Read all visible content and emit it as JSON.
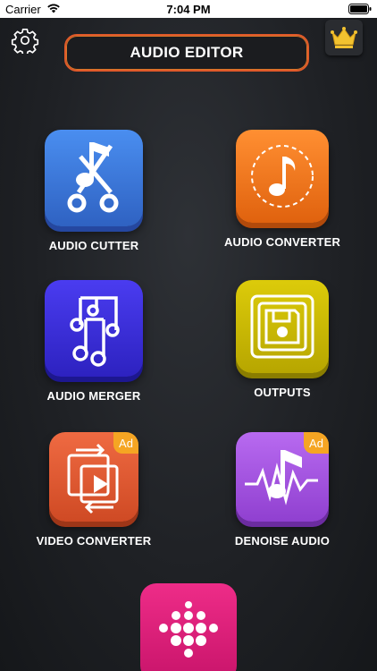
{
  "status_bar": {
    "carrier": "Carrier",
    "time": "7:04 PM"
  },
  "header": {
    "title": "AUDIO EDITOR"
  },
  "tiles": [
    {
      "label": "AUDIO CUTTER",
      "color": "#3f7fd9"
    },
    {
      "label": "AUDIO CONVERTER",
      "color": "#f07a1e"
    },
    {
      "label": "AUDIO MERGER",
      "color": "#3b30d8"
    },
    {
      "label": "OUTPUTS",
      "color": "#c8b800"
    },
    {
      "label": "VIDEO CONVERTER",
      "color": "#e25a36",
      "badge": "Ad"
    },
    {
      "label": "DENOISE AUDIO",
      "color": "#a64ad8",
      "badge": "Ad"
    },
    {
      "label": "",
      "color": "#e0217a"
    }
  ],
  "icons": {
    "settings": "gear-icon",
    "premium": "crown-icon",
    "cutter": "music-scissors-icon",
    "converter": "music-note-icon",
    "merger": "music-notes-icon",
    "outputs": "floppy-icon",
    "video": "video-convert-icon",
    "denoise": "waveform-icon",
    "more": "dots-icon"
  }
}
